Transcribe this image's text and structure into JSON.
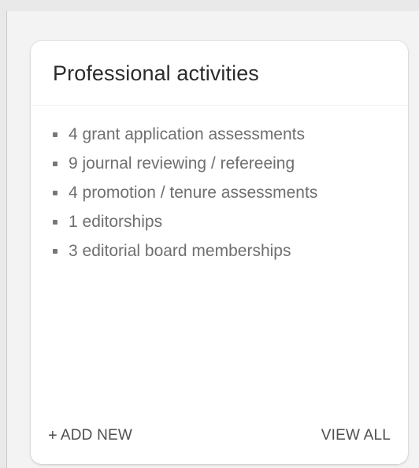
{
  "card": {
    "title": "Professional activities",
    "items": [
      {
        "text": "4 grant application assessments"
      },
      {
        "text": "9 journal reviewing / refereeing"
      },
      {
        "text": "4 promotion / tenure assessments"
      },
      {
        "text": "1 editorships"
      },
      {
        "text": "3 editorial board memberships"
      }
    ],
    "footer": {
      "add_icon": "+",
      "add_label": "ADD NEW",
      "view_all_label": "VIEW ALL"
    }
  },
  "colors": {
    "page_background": "#e9e9e9",
    "card_background": "#ffffff",
    "text_primary": "#2b2b2b",
    "text_secondary": "#6f6f6f",
    "action_text": "#4e4e4e"
  }
}
